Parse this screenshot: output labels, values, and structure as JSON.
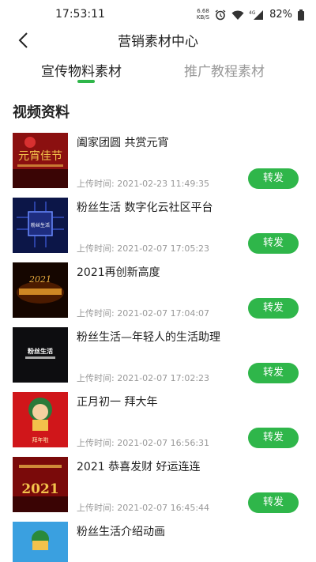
{
  "status_bar": {
    "time": "17:53:11",
    "net_speed_value": "6.68",
    "net_speed_unit": "KB/S",
    "network_type": "4G",
    "battery": "82%",
    "icons": [
      "alarm-icon",
      "wifi-icon",
      "signal-icon",
      "battery-icon"
    ]
  },
  "header": {
    "back_icon": "chevron-left-icon",
    "title": "营销素材中心"
  },
  "tabs": [
    {
      "label": "宣传物料素材",
      "active": true
    },
    {
      "label": "推广教程素材",
      "active": false
    }
  ],
  "accent_color": "#2fb64a",
  "section_title": "视频资料",
  "items": [
    {
      "title": "阖家团圆 共赏元宵",
      "date": "上传时间: 2021-02-23 11:49:35",
      "share_label": "转发",
      "thumb_text": "元宵佳节"
    },
    {
      "title": "粉丝生活 数字化云社区平台",
      "date": "上传时间: 2021-02-07 17:05:23",
      "share_label": "转发",
      "thumb_text": "粉丝生活"
    },
    {
      "title": "2021再创新高度",
      "date": "上传时间: 2021-02-07 17:04:07",
      "share_label": "转发",
      "thumb_text": "2021"
    },
    {
      "title": "粉丝生活—年轻人的生活助理",
      "date": "上传时间: 2021-02-07 17:02:23",
      "share_label": "转发",
      "thumb_text": "粉丝生活"
    },
    {
      "title": "正月初一  拜大年",
      "date": "上传时间: 2021-02-07 16:56:31",
      "share_label": "转发",
      "thumb_text": "拜年啦"
    },
    {
      "title": "2021 恭喜发财 好运连连",
      "date": "上传时间: 2021-02-07 16:45:44",
      "share_label": "转发",
      "thumb_text": "2021"
    },
    {
      "title": "粉丝生活介绍动画",
      "date": "",
      "share_label": "",
      "thumb_text": ""
    }
  ]
}
